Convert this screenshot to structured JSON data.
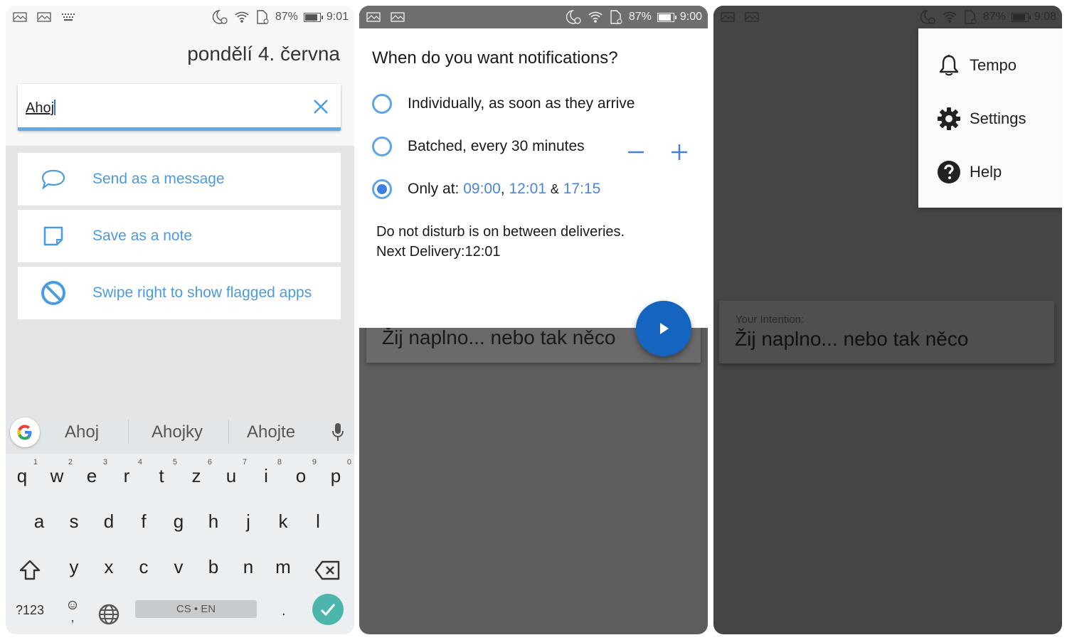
{
  "panel1": {
    "status": {
      "battery": "87%",
      "battery_level": 0.87,
      "time": "9:01"
    },
    "date": "pondělí 4. června",
    "search": {
      "value": "Ahoj"
    },
    "results": [
      {
        "icon": "chat-bubble-icon",
        "label": "Send as a message"
      },
      {
        "icon": "note-icon",
        "label": "Save as a note"
      },
      {
        "icon": "blocked-icon",
        "label": "Swipe right to show flagged apps"
      }
    ],
    "keyboard": {
      "suggestions": [
        "Ahoj",
        "Ahojky",
        "Ahojte"
      ],
      "row1": [
        "q",
        "w",
        "e",
        "r",
        "t",
        "z",
        "u",
        "i",
        "o",
        "p"
      ],
      "row1_hints": [
        "1",
        "2",
        "3",
        "4",
        "5",
        "6",
        "7",
        "8",
        "9",
        "0"
      ],
      "row2": [
        "a",
        "s",
        "d",
        "f",
        "g",
        "h",
        "j",
        "k",
        "l"
      ],
      "row3": [
        "y",
        "x",
        "c",
        "v",
        "b",
        "n",
        "m"
      ],
      "symbols_label": "?123",
      "comma_label": ",",
      "space_label": "CS • EN",
      "period_label": "."
    }
  },
  "panel2": {
    "status": {
      "battery": "87%",
      "battery_level": 0.87,
      "time": "9:00"
    },
    "title": "When do you want notifications?",
    "options": [
      {
        "label": "Individually, as soon as they arrive",
        "selected": false
      },
      {
        "label": "Batched, every 30 minutes",
        "selected": false
      },
      {
        "label_prefix": "Only at:",
        "times": [
          "09:00",
          "12:01",
          "17:15"
        ],
        "sep1": ",",
        "sep2": "&",
        "selected": true
      }
    ],
    "dnd_line1": "Do not disturb is on between deliveries.",
    "dnd_line2": "Next Delivery:12:01",
    "intention": "Žij naplno... nebo tak něco"
  },
  "panel3": {
    "status": {
      "battery": "87%",
      "battery_level": 0.87,
      "time": "9:08"
    },
    "menu": [
      {
        "icon": "bell-icon",
        "label": "Tempo"
      },
      {
        "icon": "gear-icon",
        "label": "Settings"
      },
      {
        "icon": "help-icon",
        "label": "Help"
      }
    ],
    "intention_label": "Your Intention:",
    "intention": "Žij naplno... nebo tak něco"
  }
}
